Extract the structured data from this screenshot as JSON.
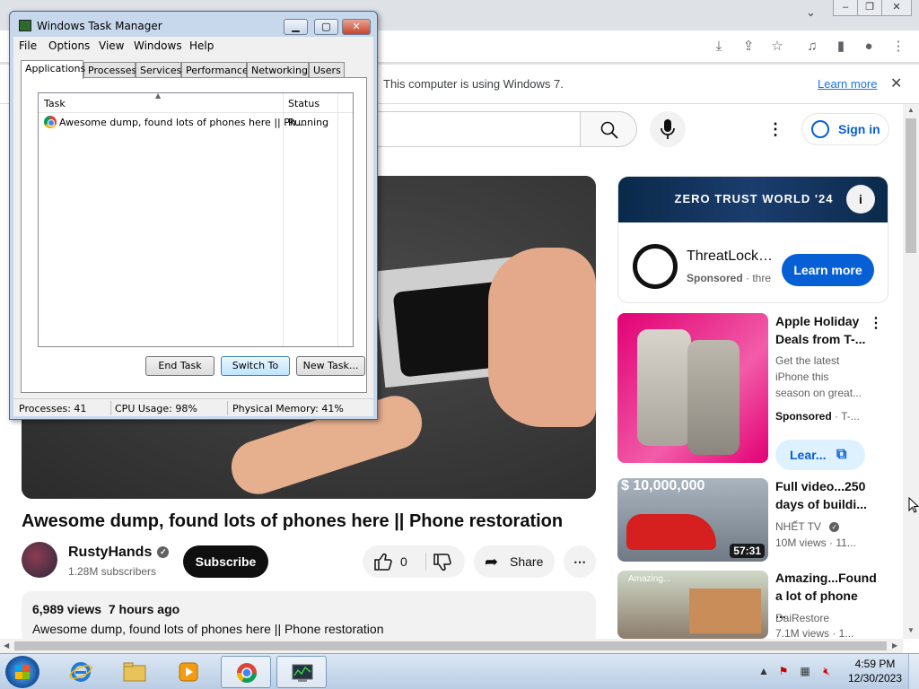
{
  "browser": {
    "infobar": {
      "message": "This computer is using Windows 7.",
      "learn_more": "Learn more"
    }
  },
  "youtube": {
    "sign_in": "Sign in",
    "video": {
      "title": "Awesome dump, found lots of phones here || Phone restoration",
      "channel": "RustyHands",
      "subscribers": "1.28M subscribers",
      "subscribe_label": "Subscribe",
      "likes": "0",
      "share_label": "Share",
      "views": "6,989 views",
      "uploaded": "7 hours ago",
      "description": "Awesome dump, found lots of phones here || Phone restoration"
    },
    "ad": {
      "banner": "ZERO TRUST WORLD '24",
      "advertiser": "ThreatLock…",
      "sponsored": "Sponsored",
      "domain": "· thre",
      "cta": "Learn more"
    },
    "recommendations": [
      {
        "title": "Apple Holiday Deals from T-...",
        "desc": "Get the latest iPhone this season on great...",
        "meta": "Sponsored",
        "meta2": "· T-...",
        "cta": "Lear..."
      },
      {
        "title": "Full video...250 days of buildi...",
        "channel": "NHẾT TV",
        "meta": "10M views · 11...",
        "duration": "57:31",
        "overlay": "$ 10,000,000"
      },
      {
        "title": "Amazing...Found a lot of phone ...",
        "channel": "DaiRestore",
        "meta": "7.1M views · 1...",
        "overlay": "Amazing..."
      }
    ]
  },
  "taskmgr": {
    "title": "Windows Task Manager",
    "menu": [
      "File",
      "Options",
      "View",
      "Windows",
      "Help"
    ],
    "tabs": [
      "Applications",
      "Processes",
      "Services",
      "Performance",
      "Networking",
      "Users"
    ],
    "columns": [
      "Task",
      "Status"
    ],
    "rows": [
      {
        "task": "Awesome dump, found lots of phones here || Ph...",
        "status": "Running"
      }
    ],
    "buttons": [
      "End Task",
      "Switch To",
      "New Task..."
    ],
    "status": {
      "processes": "Processes: 41",
      "cpu": "CPU Usage: 98%",
      "memory": "Physical Memory: 41%"
    }
  },
  "taskbar": {
    "time": "4:59 PM",
    "date": "12/30/2023"
  }
}
